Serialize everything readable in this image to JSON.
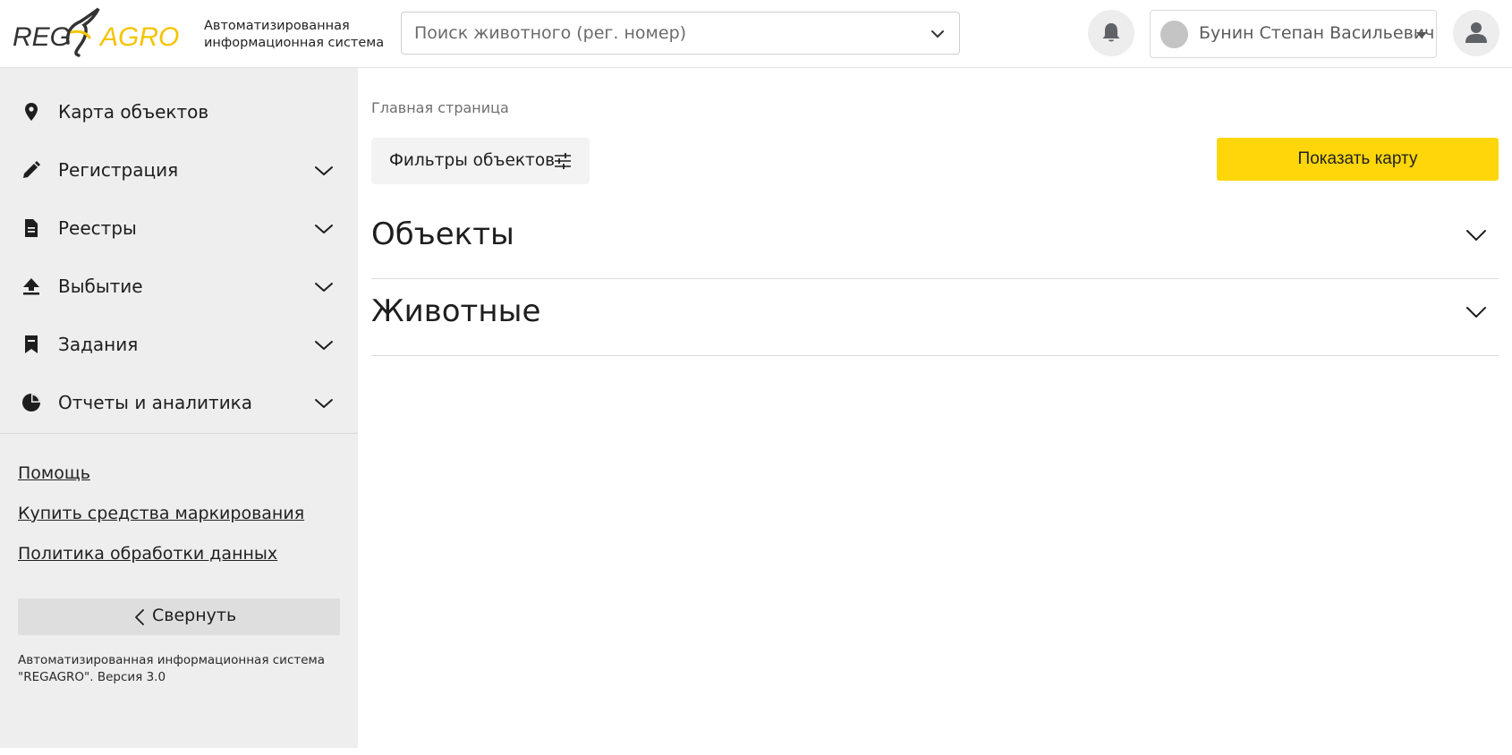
{
  "header": {
    "logo": {
      "text_reg": "REG",
      "text_agro": "AGRO",
      "accent_color": "#f5c400"
    },
    "logo_caption_line1": "Автоматизированная",
    "logo_caption_line2": "информационная система",
    "search": {
      "placeholder": "Поиск животного (рег. номер)",
      "value": "",
      "icon": "chevron-down-icon"
    },
    "notifications": {
      "icon": "bell-icon"
    },
    "user": {
      "name": "Бунин Степан Васильевич",
      "icon": "caret-down-icon"
    },
    "profile": {
      "icon": "user-icon"
    }
  },
  "sidebar": {
    "items": [
      {
        "label": "Карта объектов",
        "icon": "map-pin-icon",
        "expandable": false
      },
      {
        "label": "Регистрация",
        "icon": "pencil-icon",
        "expandable": true
      },
      {
        "label": "Реестры",
        "icon": "document-icon",
        "expandable": true
      },
      {
        "label": "Выбытие",
        "icon": "upload-icon",
        "expandable": true
      },
      {
        "label": "Задания",
        "icon": "bookmark-icon",
        "expandable": true
      },
      {
        "label": "Отчеты и аналитика",
        "icon": "pie-chart-icon",
        "expandable": true
      }
    ],
    "links": [
      {
        "label": "Помощь"
      },
      {
        "label": "Купить средства маркирования"
      },
      {
        "label": "Политика обработки данных"
      }
    ],
    "collapse_label": "Свернуть",
    "footer_line1": "Автоматизированная информационная система",
    "footer_line2": "\"REGAGRO\". Версия 3.0"
  },
  "main": {
    "breadcrumb": "Главная страница",
    "filters_label": "Фильтры объектов",
    "show_map_label": "Показать карту",
    "accent_color": "#ffd60a",
    "sections": [
      {
        "title": "Объекты"
      },
      {
        "title": "Животные"
      }
    ]
  }
}
